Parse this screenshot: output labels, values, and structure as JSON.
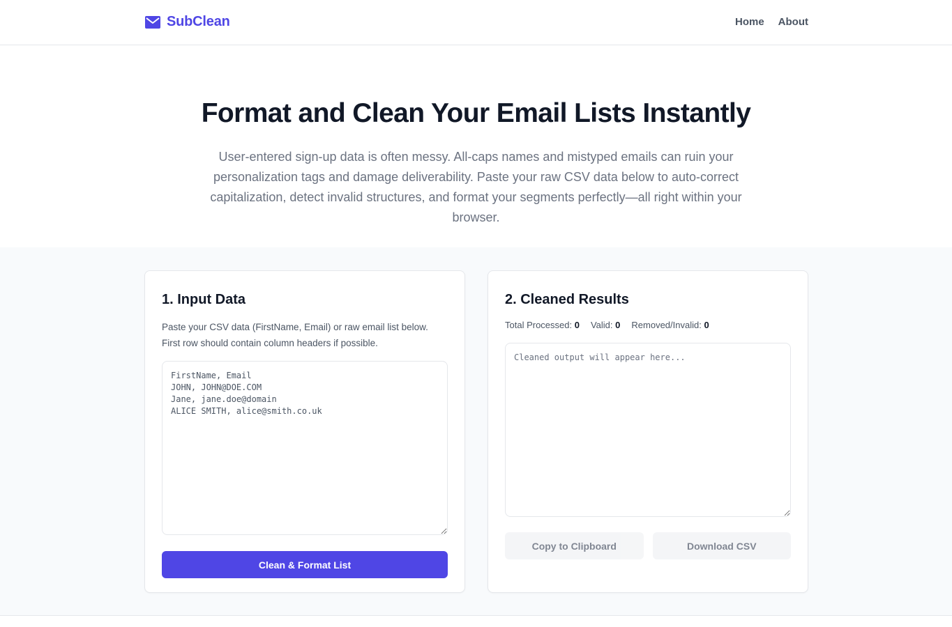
{
  "brand": {
    "name": "SubClean",
    "icon": "envelope-icon",
    "color": "#4f46e5"
  },
  "nav": {
    "items": [
      {
        "label": "Home"
      },
      {
        "label": "About"
      }
    ]
  },
  "hero": {
    "title": "Format and Clean Your Email Lists Instantly",
    "description": "User-entered sign-up data is often messy. All-caps names and mistyped emails can ruin your personalization tags and damage deliverability. Paste your raw CSV data below to auto-correct capitalization, detect invalid structures, and format your segments perfectly—all right within your browser."
  },
  "input_panel": {
    "title": "1. Input Data",
    "description_line1": "Paste your CSV data (FirstName, Email) or raw email list below.",
    "description_line2": "First row should contain column headers if possible.",
    "textarea_value": "FirstName, Email\nJOHN, JOHN@DOE.COM\nJane, jane.doe@domain\nALICE SMITH, alice@smith.co.uk",
    "button_label": "Clean & Format List"
  },
  "results_panel": {
    "title": "2. Cleaned Results",
    "stats": {
      "total_label": "Total Processed:",
      "total_value": "0",
      "valid_label": "Valid:",
      "valid_value": "0",
      "removed_label": "Removed/Invalid:",
      "removed_value": "0"
    },
    "output_placeholder": "Cleaned output will appear here...",
    "copy_label": "Copy to Clipboard",
    "download_label": "Download CSV"
  }
}
